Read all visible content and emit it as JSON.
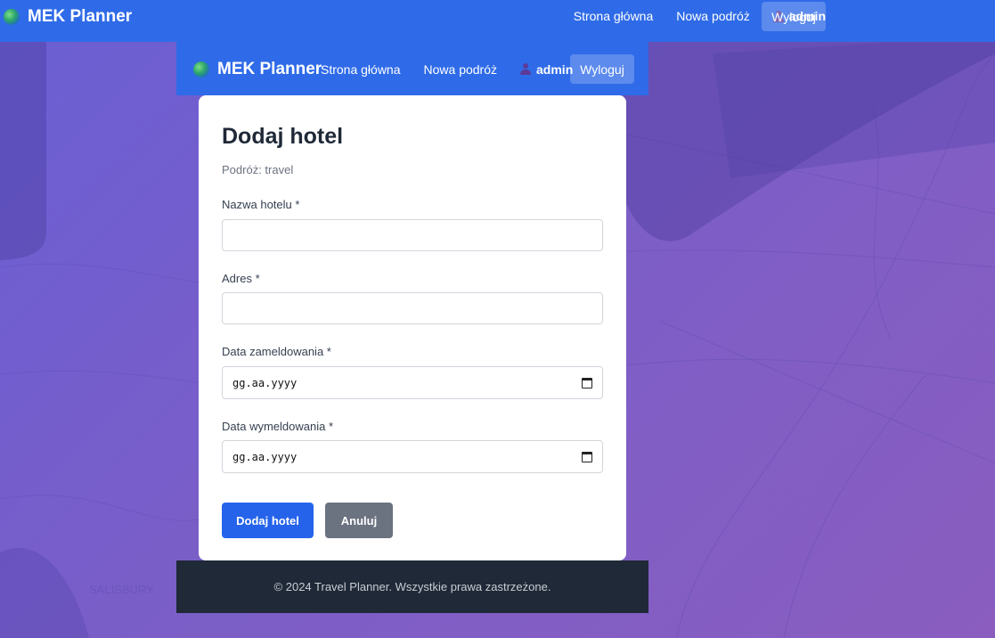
{
  "app": {
    "brand": "MEK Planner"
  },
  "nav": {
    "home": "Strona główna",
    "new_trip": "Nowa podróż",
    "user": "admin",
    "logout": "Wyloguj"
  },
  "form": {
    "title": "Dodaj hotel",
    "subtitle": "Podróż: travel",
    "fields": {
      "hotel_name": {
        "label": "Nazwa hotelu *",
        "value": ""
      },
      "address": {
        "label": "Adres *",
        "value": ""
      },
      "check_in": {
        "label": "Data zameldowania *",
        "placeholder": "gg.aa.yyyy"
      },
      "check_out": {
        "label": "Data wymeldowania *",
        "placeholder": "gg.aa.yyyy"
      }
    },
    "submit": "Dodaj hotel",
    "cancel": "Anuluj"
  },
  "background": {
    "map_label": "SALISBURY"
  },
  "footer": {
    "text": "© 2024 Travel Planner. Wszystkie prawa zastrzeżone."
  },
  "colors": {
    "navbar": "#2f6be8",
    "primary_button": "#2563eb",
    "secondary_button": "#6b7280",
    "footer": "#1f2937",
    "background": "#7a5ec8"
  }
}
